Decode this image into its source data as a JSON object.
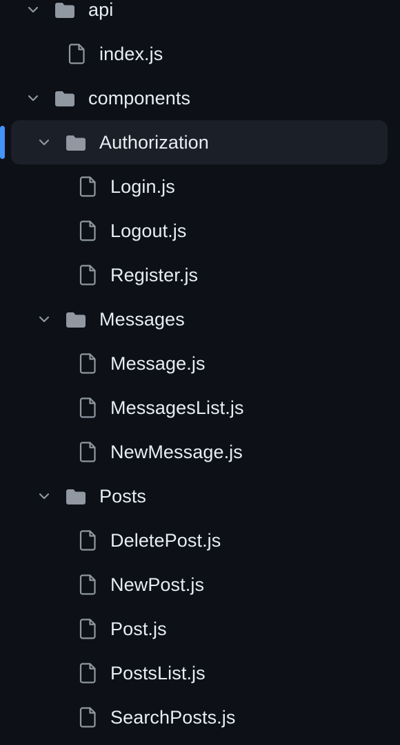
{
  "colors": {
    "background": "#0d1117",
    "selected_row": "#1b2028",
    "accent": "#4493f8",
    "text": "#e6edf3",
    "icon": "#9198a1"
  },
  "tree": {
    "selected_item": "Authorization",
    "items": [
      {
        "label": "api",
        "type": "folder",
        "icon": "folder-icon",
        "expanded": true,
        "depth": 0
      },
      {
        "label": "index.js",
        "type": "file",
        "icon": "file-icon",
        "depth": 1
      },
      {
        "label": "components",
        "type": "folder",
        "icon": "folder-icon",
        "expanded": true,
        "depth": 0
      },
      {
        "label": "Authorization",
        "type": "folder",
        "icon": "folder-icon",
        "expanded": true,
        "depth": 1
      },
      {
        "label": "Login.js",
        "type": "file",
        "icon": "file-icon",
        "depth": 2
      },
      {
        "label": "Logout.js",
        "type": "file",
        "icon": "file-icon",
        "depth": 2
      },
      {
        "label": "Register.js",
        "type": "file",
        "icon": "file-icon",
        "depth": 2
      },
      {
        "label": "Messages",
        "type": "folder",
        "icon": "folder-icon",
        "expanded": true,
        "depth": 1
      },
      {
        "label": "Message.js",
        "type": "file",
        "icon": "file-icon",
        "depth": 2
      },
      {
        "label": "MessagesList.js",
        "type": "file",
        "icon": "file-icon",
        "depth": 2
      },
      {
        "label": "NewMessage.js",
        "type": "file",
        "icon": "file-icon",
        "depth": 2
      },
      {
        "label": "Posts",
        "type": "folder",
        "icon": "folder-icon",
        "expanded": true,
        "depth": 1
      },
      {
        "label": "DeletePost.js",
        "type": "file",
        "icon": "file-icon",
        "depth": 2
      },
      {
        "label": "NewPost.js",
        "type": "file",
        "icon": "file-icon",
        "depth": 2
      },
      {
        "label": "Post.js",
        "type": "file",
        "icon": "file-icon",
        "depth": 2
      },
      {
        "label": "PostsList.js",
        "type": "file",
        "icon": "file-icon",
        "depth": 2
      },
      {
        "label": "SearchPosts.js",
        "type": "file",
        "icon": "file-icon",
        "depth": 2
      }
    ]
  }
}
